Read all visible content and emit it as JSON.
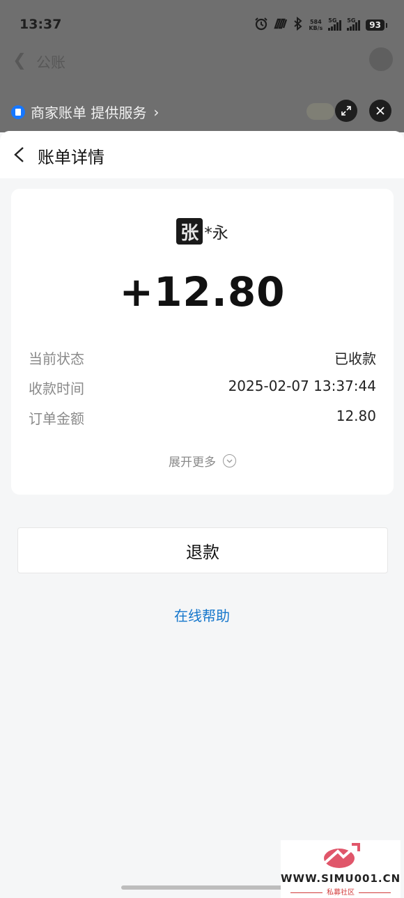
{
  "status_bar": {
    "time": "13:37",
    "net_speed_value": "584",
    "net_speed_unit": "KB/s",
    "sim1_label": "5G",
    "sim2_label": "5G",
    "battery": "93"
  },
  "background_app": {
    "title": "公账"
  },
  "mini_program_bar": {
    "label": "商家账单 提供服务"
  },
  "nav": {
    "title": "账单详情"
  },
  "bill": {
    "payer_avatar_char": "张",
    "payer_name": "*永",
    "amount": "+12.80",
    "rows": [
      {
        "label": "当前状态",
        "value": "已收款"
      },
      {
        "label": "收款时间",
        "value": "2025-02-07 13:37:44"
      },
      {
        "label": "订单金额",
        "value": "12.80"
      }
    ],
    "expand_label": "展开更多"
  },
  "actions": {
    "refund_label": "退款",
    "help_label": "在线帮助"
  },
  "watermark": {
    "text": "WWW.SIMU001.CN",
    "sub": "私募社区"
  },
  "colors": {
    "link": "#1677cc",
    "brand": "#1677ff",
    "watermark_red": "#d23a3a"
  }
}
